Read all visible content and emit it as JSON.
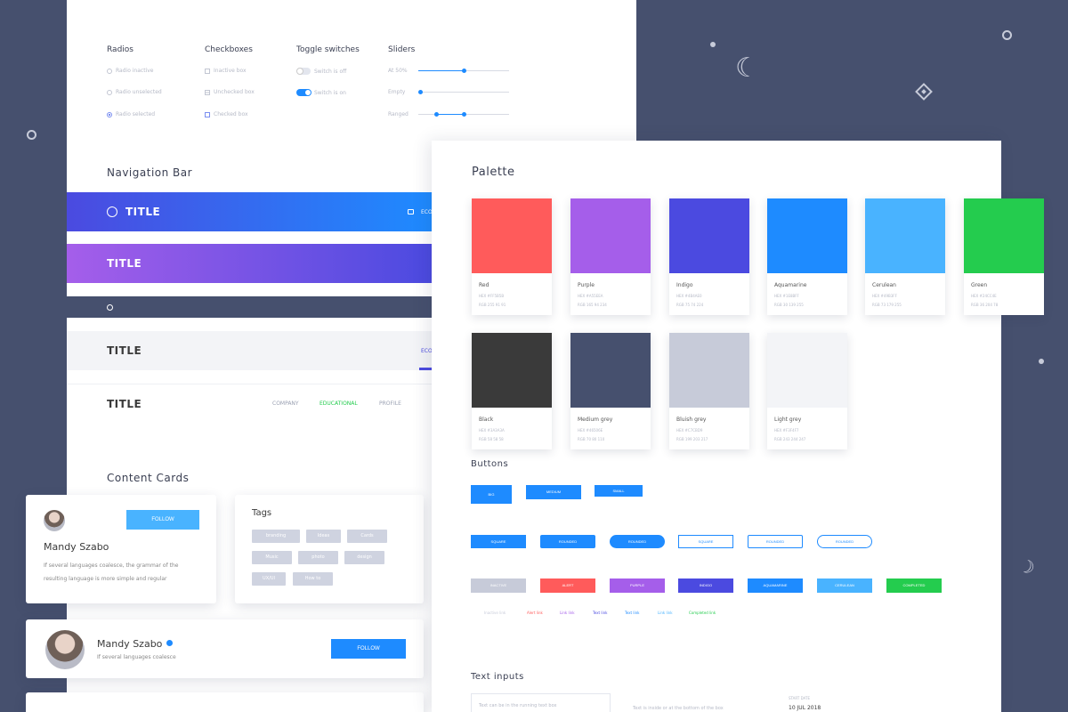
{
  "controls": {
    "radios": {
      "heading": "Radios",
      "items": [
        "Radio inactive",
        "Radio unselected",
        "Radio selected"
      ]
    },
    "checkboxes": {
      "heading": "Checkboxes",
      "items": [
        "Inactive box",
        "Unchecked box",
        "Checked box"
      ]
    },
    "toggles": {
      "heading": "Toggle switches",
      "items": [
        "Switch is off",
        "Switch is on"
      ]
    },
    "sliders": {
      "heading": "Sliders",
      "items": [
        {
          "label": "At 50%",
          "value": 0.5
        },
        {
          "label": "Empty",
          "value": 0.0
        },
        {
          "label": "Ranged",
          "range": [
            0.2,
            0.5
          ]
        }
      ]
    }
  },
  "navigation": {
    "heading": "Navigation Bar",
    "bar1": {
      "title": "TITLE",
      "link": "ECO"
    },
    "bar2": {
      "title": "TITLE"
    },
    "bar4": {
      "title": "TITLE",
      "link": "ECO"
    },
    "bar5": {
      "title": "TITLE",
      "links": [
        "COMPANY",
        "EDUCATIONAL",
        "PROFILE"
      ]
    }
  },
  "cards": {
    "heading": "Content Cards",
    "profile1": {
      "name": "Mandy Szabo",
      "button": "FOLLOW",
      "text1": "If several languages coalesce, the grammar of the",
      "text2": "resulting language is more simple and regular"
    },
    "tags": {
      "heading": "Tags",
      "items": [
        "branding",
        "Ideas",
        "Cards",
        "Music",
        "photo",
        "design",
        "UX/UI",
        "How to"
      ]
    },
    "profile2": {
      "name": "Mandy Szabo",
      "button": "FOLLOW",
      "text": "If several languages coalesce"
    }
  },
  "palette": {
    "heading": "Palette",
    "swatches": [
      {
        "name": "Red",
        "hex": "HEX  #FF5B5B",
        "rgb": "RGB  255 91 91",
        "color": "#ff5b5b"
      },
      {
        "name": "Purple",
        "hex": "HEX  #A55EEA",
        "rgb": "RGB  165 94 234",
        "color": "#a55eea"
      },
      {
        "name": "Indigo",
        "hex": "HEX  #4B4AE0",
        "rgb": "RGB  75 74 224",
        "color": "#4b4ae0"
      },
      {
        "name": "Aquamarine",
        "hex": "HEX  #1E8BFF",
        "rgb": "RGB  30 139 255",
        "color": "#1e8bff"
      },
      {
        "name": "Cerulean",
        "hex": "HEX  #49B3FF",
        "rgb": "RGB  73 179 255",
        "color": "#49b3ff"
      },
      {
        "name": "Green",
        "hex": "HEX  #24CC4E",
        "rgb": "RGB  36 204 78",
        "color": "#24cc4e"
      },
      {
        "name": "Black",
        "hex": "HEX  #3A3A3A",
        "rgb": "RGB  58 58 58",
        "color": "#3a3a3a"
      },
      {
        "name": "Medium grey",
        "hex": "HEX  #46506E",
        "rgb": "RGB  70 80 110",
        "color": "#46506e"
      },
      {
        "name": "Bluish grey",
        "hex": "HEX  #C7CBD9",
        "rgb": "RGB  199 203 217",
        "color": "#c7cbd9"
      },
      {
        "name": "Light grey",
        "hex": "HEX  #F3F4F7",
        "rgb": "RGB  243 244 247",
        "color": "#f3f4f7"
      }
    ]
  },
  "buttons": {
    "heading": "Buttons",
    "sizes": [
      "BIG",
      "MEDIUM",
      "SMALL"
    ],
    "shapes": [
      "SQUARE",
      "ROUNDED",
      "ROUNDED",
      "SQUARE",
      "ROUNDED",
      "ROUNDED"
    ],
    "colors": [
      "INACTIVE",
      "ALERT",
      "PURPLE",
      "INDIGO",
      "AQUAMARINE",
      "CERULEAN",
      "COMPLETED"
    ],
    "text_buttons": [
      "Inactive link",
      "Alert link",
      "Link link",
      "Text link",
      "Text link",
      "Link link",
      "Completed link"
    ]
  },
  "inputs": {
    "heading": "Text inputs",
    "placeholder": "Text can be in the running text box",
    "helper": "Text is inside or at the bottom of the box",
    "date_label": "START DATE",
    "date_value": "10 JUL 2018"
  }
}
